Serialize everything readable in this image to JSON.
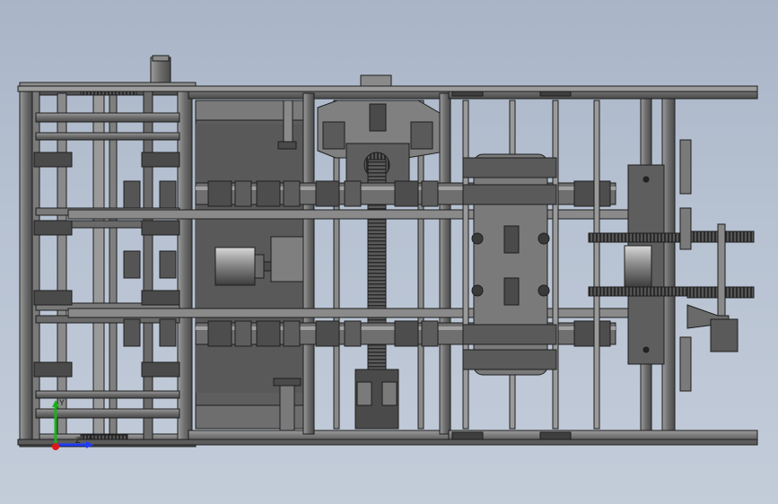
{
  "viewport": {
    "background_top": "#a9b5c7",
    "background_bottom": "#c3ccd9",
    "part_color": "#6f6f6f",
    "part_dark": "#3a3a3a",
    "part_light": "#9a9a9a",
    "edge_color": "#1e1e1e"
  },
  "triad": {
    "x_label": "X",
    "y_label": "Y",
    "z_label": "Z",
    "x_color": "#1e3cff",
    "y_color": "#19b219",
    "z_color": "#e01818"
  }
}
